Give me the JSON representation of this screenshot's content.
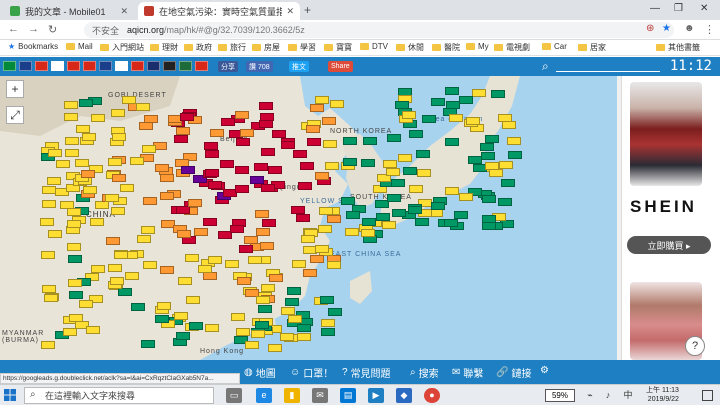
{
  "browser": {
    "tabs": [
      {
        "title": "我的文章 - Mobile01",
        "favicon_color": "#3aa34a"
      },
      {
        "title": "在地空氣污染：實時空氣質量指數",
        "favicon_color": "#c0392b"
      }
    ],
    "address": {
      "security": "不安全",
      "host": "aqicn.org",
      "path": "/map/hk/#@g/32.7039/120.3662/5z"
    },
    "bookmarks": [
      "Bookmarks",
      "Mail",
      "入門網站",
      "理財",
      "政府",
      "旅行",
      "房屋",
      "學習",
      "寶寶",
      "DTV",
      "休閒",
      "醫院",
      "My",
      "電視劇",
      "Car",
      "居家",
      "其他書籤"
    ]
  },
  "site": {
    "share_label": "分享",
    "like_label": "讚 708",
    "tweet_label": "推文",
    "g_share_label": "Share",
    "clock": "11:12",
    "flags": [
      "#008a39",
      "#1a3e8a",
      "#d62718",
      "#ffffff",
      "#d62718",
      "#d62718",
      "#1a3e8a",
      "#ffffff",
      "#d62718",
      "#1a2e6e",
      "#222222",
      "#1e6b3a",
      "#d62718"
    ]
  },
  "map": {
    "labels": [
      "GOBI DESERT",
      "CHINA",
      "NORTH KOREA",
      "SOUTH KOREA",
      "YELLOW SEA",
      "EAST CHINA SEA",
      "Beijing",
      "Qingdao",
      "MYANMAR (BURMA)",
      "Hong Kong",
      "Sea of Japan"
    ],
    "zoom_in": "+",
    "zoom_out": "−",
    "fullscreen": "⤢"
  },
  "ad": {
    "brand": "SHEIN",
    "cta": "立即購買 ▸"
  },
  "bottom_nav": [
    {
      "icon": "globe-icon",
      "glyph": "◍",
      "label": "地圖"
    },
    {
      "icon": "mask-icon",
      "glyph": "☺",
      "label": "口罩！"
    },
    {
      "icon": "question-icon",
      "glyph": "?",
      "label": "常見問題"
    },
    {
      "icon": "search-icon",
      "glyph": "⌕",
      "label": "搜索"
    },
    {
      "icon": "contact-icon",
      "glyph": "✉",
      "label": "聯繫"
    },
    {
      "icon": "link-icon",
      "glyph": "🔗",
      "label": "鏈接"
    },
    {
      "icon": "settings-icon",
      "glyph": "⚙",
      "label": ""
    }
  ],
  "status_url": "https://googleads.g.doubleclick.net/aclk?sa=l&ai=CxRqztClaGXab5N7a...",
  "taskbar": {
    "search_placeholder": "在這裡輸入文字來搜尋",
    "battery": "59%",
    "time": "上午 11:13",
    "date": "2019/9/22"
  },
  "colors": {
    "bar_blue": "#1e7fc2",
    "good": "#009966",
    "moderate": "#ffde33",
    "usg": "#ff9933",
    "unhealthy": "#cc0033",
    "very_unhealthy": "#660099"
  }
}
